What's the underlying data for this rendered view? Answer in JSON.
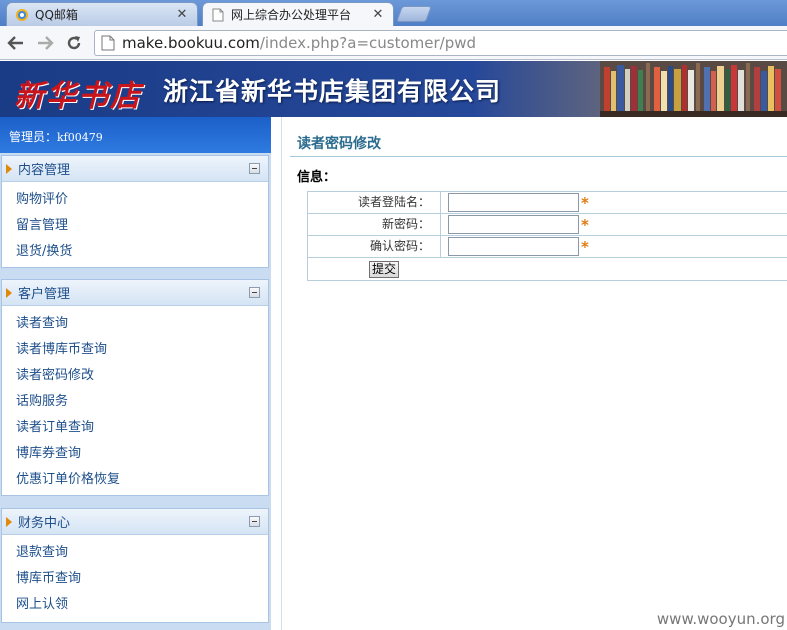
{
  "browser": {
    "tabs": [
      {
        "title": "QQ邮箱",
        "active": false
      },
      {
        "title": "网上综合办公处理平台",
        "active": true
      }
    ],
    "url_host": "make.bookuu.com",
    "url_path": "/index.php?a=customer/pwd"
  },
  "banner": {
    "logo_text": "新华书店",
    "company": "浙江省新华书店集团有限公司"
  },
  "sidebar": {
    "admin_label": "管理员：",
    "admin_name": "kf00479",
    "panels": [
      {
        "title": "内容管理",
        "items": [
          "购物评价",
          "留言管理",
          "退货/换货"
        ]
      },
      {
        "title": "客户管理",
        "items": [
          "读者查询",
          "读者博库币查询",
          "读者密码修改",
          "话购服务",
          "读者订单查询",
          "博库券查询",
          "优惠订单价格恢复"
        ]
      },
      {
        "title": "财务中心",
        "items": [
          "退款查询",
          "博库币查询",
          "网上认领"
        ]
      }
    ]
  },
  "main": {
    "title": "读者密码修改",
    "info_label": "信息：",
    "fields": [
      {
        "label": "读者登陆名：",
        "value": ""
      },
      {
        "label": "新密码：",
        "value": ""
      },
      {
        "label": "确认密码：",
        "value": ""
      }
    ],
    "required_mark": "*",
    "submit_label": "提交"
  },
  "watermark": "www.wooyun.org",
  "colors": {
    "accent": "#2a6b8e",
    "sidebar_bg": "#c9dcf1",
    "required": "#e07c10",
    "logo_red": "#c8141a"
  }
}
